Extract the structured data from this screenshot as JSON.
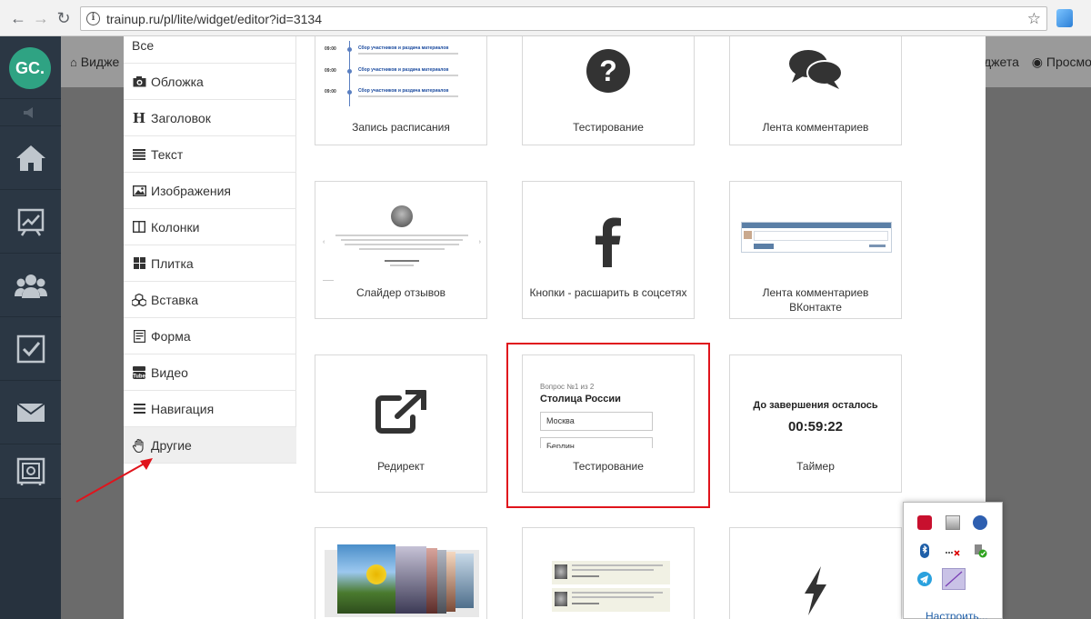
{
  "browser": {
    "url": "trainup.ru/pl/lite/widget/editor?id=3134"
  },
  "app_sidebar": {
    "logo": "GC."
  },
  "page_toolbar": {
    "left_label": "Видже",
    "right_label_1": "джета",
    "right_label_2": "Просмотр"
  },
  "menu": {
    "items": [
      {
        "label": "Все",
        "icon": "none"
      },
      {
        "label": "Обложка",
        "icon": "camera-icon"
      },
      {
        "label": "Заголовок",
        "icon": "header-icon"
      },
      {
        "label": "Текст",
        "icon": "text-lines-icon"
      },
      {
        "label": "Изображения",
        "icon": "image-icon"
      },
      {
        "label": "Колонки",
        "icon": "columns-icon"
      },
      {
        "label": "Плитка",
        "icon": "tiles-icon"
      },
      {
        "label": "Вставка",
        "icon": "cubes-icon"
      },
      {
        "label": "Форма",
        "icon": "form-icon"
      },
      {
        "label": "Видео",
        "icon": "youtube-icon"
      },
      {
        "label": "Навигация",
        "icon": "bars-icon"
      },
      {
        "label": "Другие",
        "icon": "hand-icon"
      }
    ],
    "active_index": 11
  },
  "tiles": {
    "schedule": {
      "label": "Запись расписания",
      "rows": [
        {
          "time": "09:00",
          "title": "Сбор участников и раздача материалов"
        },
        {
          "time": "09:00",
          "title": "Сбор участников и раздача материалов"
        },
        {
          "time": "09:00",
          "title": "Сбор участников и раздача материалов"
        }
      ]
    },
    "quiz_icon": {
      "label": "Тестирование"
    },
    "comments": {
      "label": "Лента комментариев"
    },
    "reviews_slider": {
      "label": "Слайдер отзывов"
    },
    "share_buttons": {
      "label": "Кнопки - расшарить в соцсетях"
    },
    "vk_comments": {
      "label_line1": "Лента комментариев",
      "label_line2": "ВКонтакте"
    },
    "redirect": {
      "label": "Редирект"
    },
    "quiz_preview": {
      "label": "Тестирование",
      "question_counter": "Вопрос №1 из 2",
      "question": "Столица России",
      "option_1": "Москва",
      "option_2": "Берлин"
    },
    "timer": {
      "label": "Таймер",
      "heading": "До завершения осталось",
      "time": "00:59:22"
    }
  },
  "tray": {
    "link": "Настроить..."
  },
  "colors": {
    "highlight": "#e0141c",
    "sidebar": "#2b3744",
    "logo": "#2fa383"
  }
}
